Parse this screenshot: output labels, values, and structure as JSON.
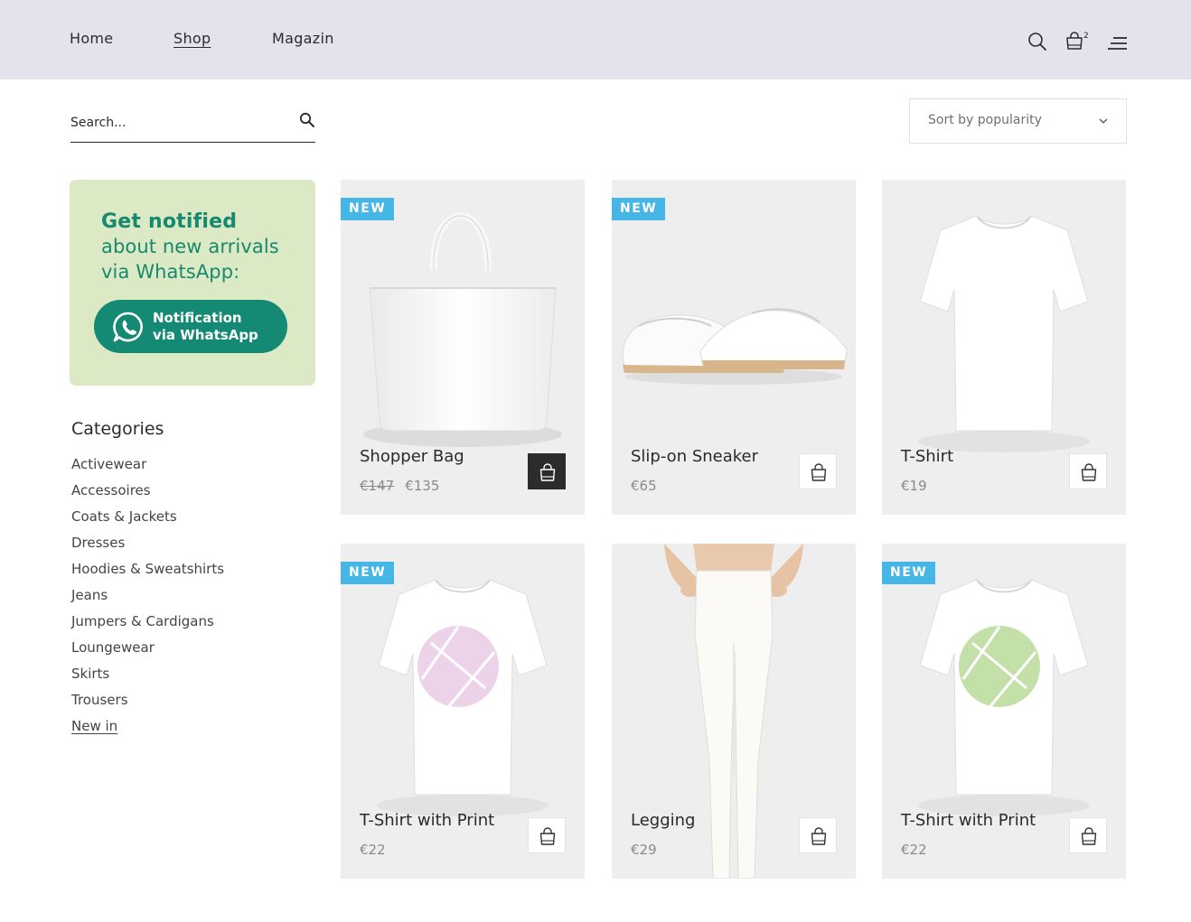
{
  "nav": {
    "items": [
      {
        "label": "Home",
        "active": false
      },
      {
        "label": "Shop",
        "active": true
      },
      {
        "label": "Magazin",
        "active": false
      }
    ],
    "cart_count": "2"
  },
  "search": {
    "placeholder": "Search..."
  },
  "sort": {
    "selected": "Sort by popularity"
  },
  "promo": {
    "title": "Get notified",
    "line2": "about new arrivals",
    "line3": "via WhatsApp:",
    "button_line1": "Notification",
    "button_line2": "via WhatsApp",
    "bg_color": "#dbe9c4",
    "accent_color": "#16896f"
  },
  "categories": {
    "title": "Categories",
    "items": [
      "Activewear",
      "Accessoires",
      "Coats & Jackets",
      "Dresses",
      "Hoodies & Sweatshirts",
      "Jeans",
      "Jumpers & Cardigans",
      "Loungewear",
      "Skirts",
      "Trousers",
      "New in"
    ]
  },
  "products": [
    {
      "name": "Shopper Bag",
      "old_price": "€147",
      "price": "€135",
      "badge": "NEW",
      "image": "white-tote-bag"
    },
    {
      "name": "Slip-on Sneaker",
      "old_price": "",
      "price": "€65",
      "badge": "NEW",
      "image": "white-slip-on-sneakers"
    },
    {
      "name": "T-Shirt",
      "old_price": "",
      "price": "€19",
      "badge": "",
      "image": "white-t-shirt"
    },
    {
      "name": "T-Shirt with Print",
      "old_price": "",
      "price": "€22",
      "badge": "NEW",
      "image": "white-t-shirt-pink-print"
    },
    {
      "name": "Legging",
      "old_price": "",
      "price": "€29",
      "badge": "",
      "image": "white-legging"
    },
    {
      "name": "T-Shirt with Print",
      "old_price": "",
      "price": "€22",
      "badge": "NEW",
      "image": "white-t-shirt-green-print"
    }
  ],
  "colors": {
    "header_bg": "#e4e2ed",
    "badge": "#45b6e6",
    "whatsapp_button": "#148a74"
  },
  "icons": {
    "search": "search-icon",
    "cart": "shopping-bag-icon",
    "menu": "hamburger-menu-icon",
    "whatsapp": "whatsapp-icon",
    "add_to_cart": "shopping-bag-icon"
  }
}
